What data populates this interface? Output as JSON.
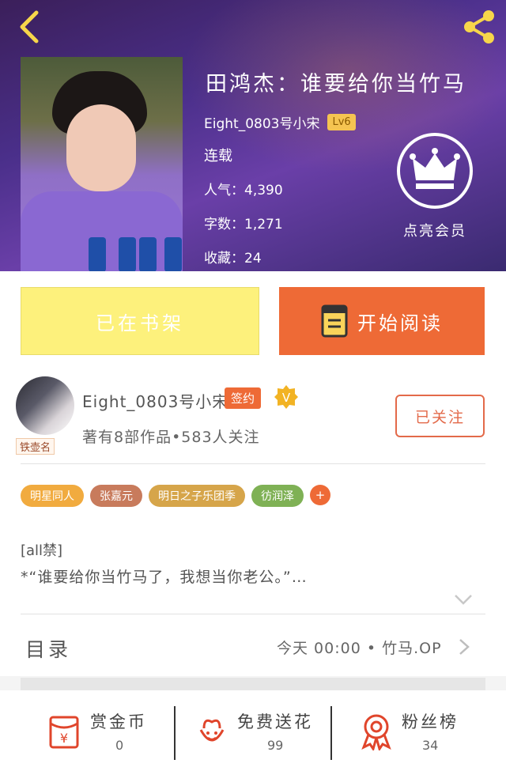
{
  "header": {
    "book_title": "田鸿杰：谁要给你当竹马",
    "author_name": "Eight_0803号小宋",
    "level": "Lv6",
    "status": "连载",
    "popularity": "人气：4,390",
    "word_count": "字数：1,271",
    "favorites": "收藏：24",
    "vip_label": "点亮会员"
  },
  "actions": {
    "shelf_label": "已在书架",
    "read_label": "开始阅读"
  },
  "author": {
    "avatar_tag": "铁壶名",
    "name": "Eight_0803号小宋",
    "sign_badge": "签约",
    "verified": "V",
    "meta": "著有8部作品•583人关注",
    "follow_label": "已关注"
  },
  "tags": [
    {
      "label": "明星同人",
      "color": "#f1ab3f"
    },
    {
      "label": "张嘉元",
      "color": "#c87b5c"
    },
    {
      "label": "明日之子乐团季",
      "color": "#d6a54a"
    },
    {
      "label": "彷润泽",
      "color": "#7fb155"
    }
  ],
  "tag_more": "+",
  "synopsis": {
    "line1": "[all禁]",
    "line2": "*“谁要给你当竹马了，我想当你老公。”…"
  },
  "toc": {
    "label": "目录",
    "latest": "今天 00:00 • 竹马.OP"
  },
  "bottom": {
    "reward": {
      "title": "赏金币",
      "count": "0"
    },
    "flower": {
      "title": "免费送花",
      "count": "99"
    },
    "fans": {
      "title": "粉丝榜",
      "count": "34"
    }
  },
  "colors": {
    "accent": "#ee6a36",
    "shelf": "#fdf17c",
    "follow": "#e36a4a"
  }
}
